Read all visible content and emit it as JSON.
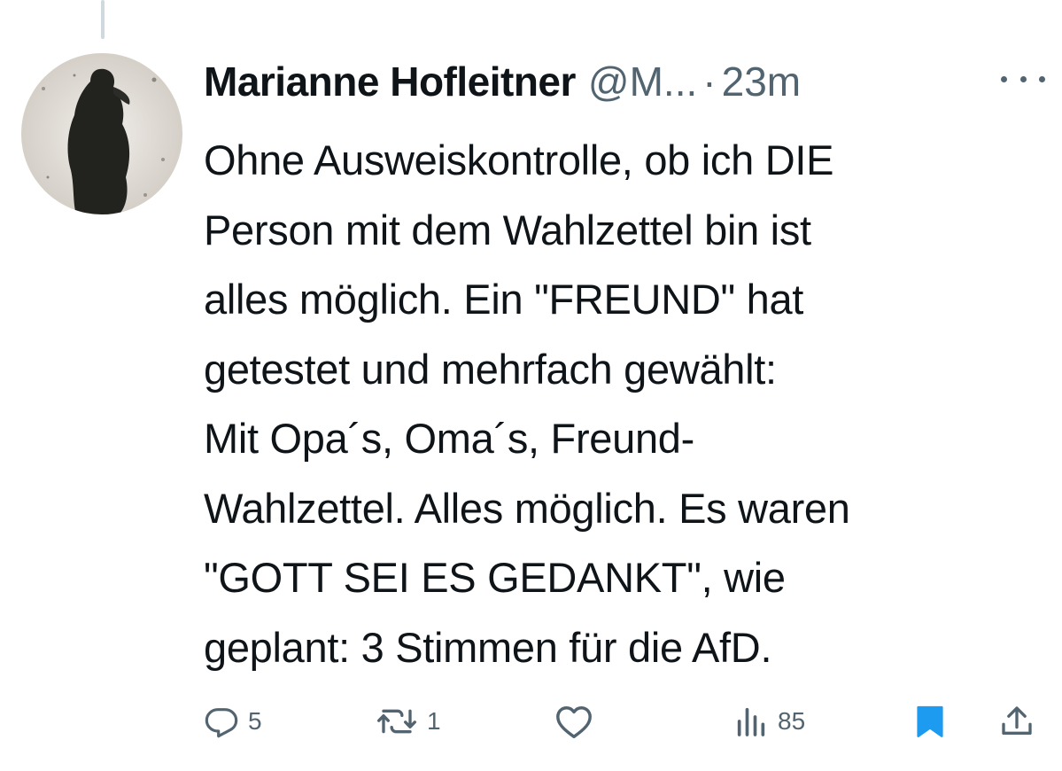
{
  "tweet": {
    "author": {
      "display_name": "Marianne Hofleitner",
      "handle": "@M...",
      "avatar_icon": "avatar-silhouette"
    },
    "separator": "·",
    "timestamp": "23m",
    "text_lines": [
      "Ohne Ausweiskontrolle, ob ich DIE",
      "Person mit dem Wahlzettel bin ist",
      "alles möglich. Ein \"FREUND\" hat",
      "getestet und mehrfach gewählt:",
      "Mit Opa´s, Oma´s, Freund-",
      "Wahlzettel. Alles möglich. Es waren",
      "\"GOTT SEI ES GEDANKT\", wie",
      "geplant: 3 Stimmen für die AfD."
    ],
    "actions": {
      "reply": {
        "icon": "reply-icon",
        "count": "5"
      },
      "retweet": {
        "icon": "retweet-icon",
        "count": "1"
      },
      "like": {
        "icon": "heart-icon",
        "count": ""
      },
      "views": {
        "icon": "views-icon",
        "count": "85"
      },
      "bookmark": {
        "icon": "bookmark-icon",
        "active": true
      },
      "share": {
        "icon": "share-icon"
      }
    }
  },
  "colors": {
    "text_primary": "#0f1419",
    "text_secondary": "#536471",
    "accent": "#1d9bf0",
    "thread_line": "#cfd9de"
  }
}
